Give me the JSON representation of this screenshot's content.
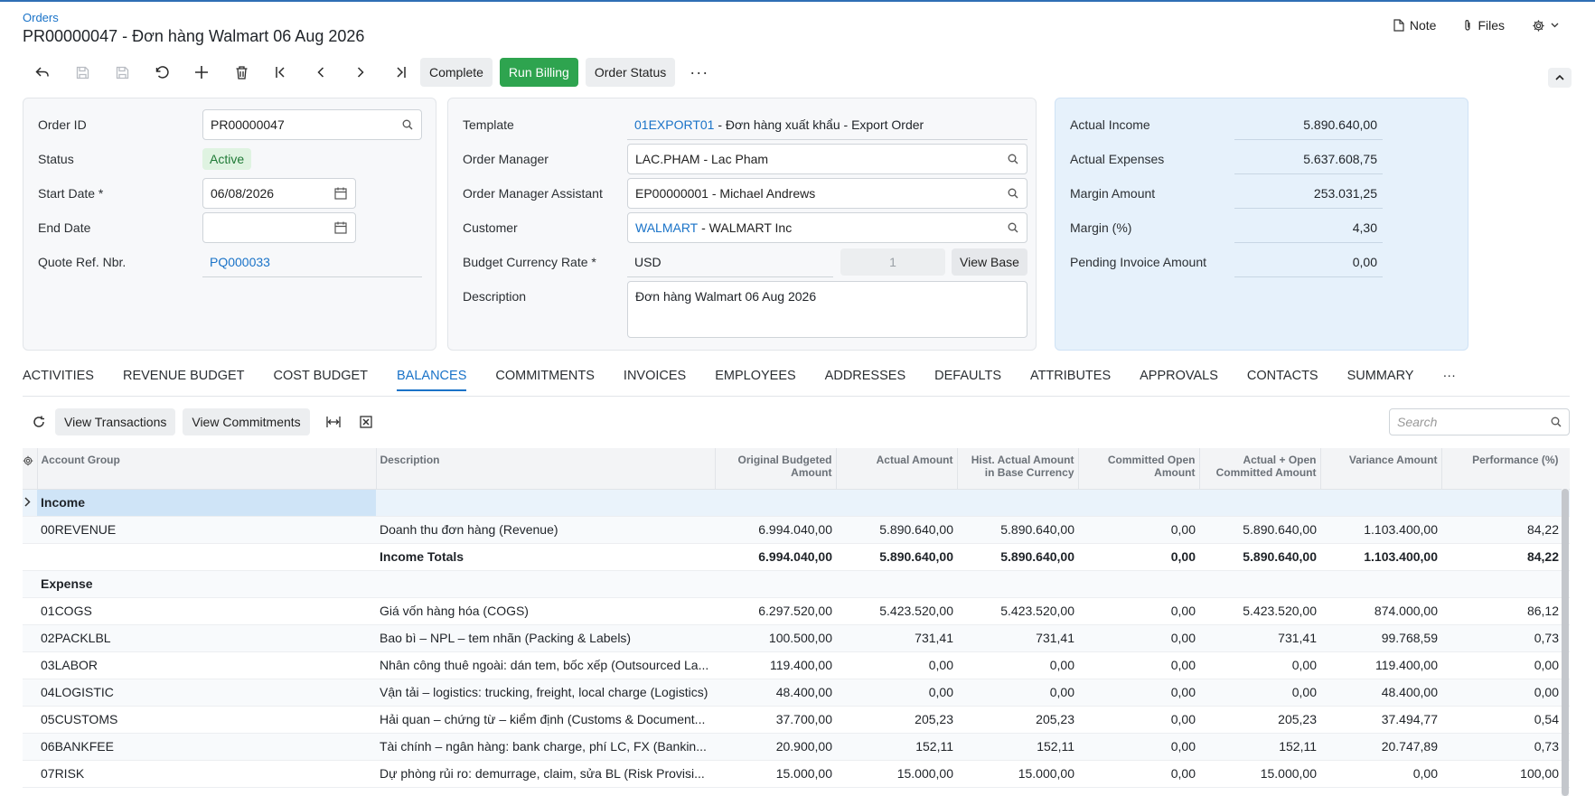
{
  "header": {
    "breadcrumb": "Orders",
    "title": "PR00000047 - Đơn hàng Walmart 06 Aug 2026",
    "note_label": "Note",
    "files_label": "Files"
  },
  "toolbar": {
    "complete_label": "Complete",
    "run_billing_label": "Run Billing",
    "order_status_label": "Order Status",
    "more_label": "···"
  },
  "summary": {
    "order_id_label": "Order ID",
    "order_id": "PR00000047",
    "status_label": "Status",
    "status": "Active",
    "start_date_label": "Start Date *",
    "start_date": "06/08/2026",
    "end_date_label": "End Date",
    "end_date": "",
    "quote_ref_label": "Quote Ref. Nbr.",
    "quote_ref": "PQ000033",
    "template_label": "Template",
    "template_code": "01EXPORT01",
    "template_desc": " - Đơn hàng xuất khẩu - Export Order",
    "order_manager_label": "Order Manager",
    "order_manager": "LAC.PHAM - Lac Pham",
    "order_manager_assistant_label": "Order Manager Assistant",
    "order_manager_assistant": "EP00000001 - Michael Andrews",
    "customer_label": "Customer",
    "customer_code": "WALMART",
    "customer_desc": " - WALMART Inc",
    "budget_currency_label": "Budget Currency Rate *",
    "budget_currency": "USD",
    "currency_rate": "1",
    "view_base_label": "View Base",
    "description_label": "Description",
    "description": "Đơn hàng Walmart 06 Aug 2026"
  },
  "totals": {
    "actual_income_label": "Actual Income",
    "actual_income": "5.890.640,00",
    "actual_expenses_label": "Actual Expenses",
    "actual_expenses": "5.637.608,75",
    "margin_amount_label": "Margin Amount",
    "margin_amount": "253.031,25",
    "margin_pct_label": "Margin (%)",
    "margin_pct": "4,30",
    "pending_invoice_label": "Pending Invoice Amount",
    "pending_invoice": "0,00"
  },
  "tabs": [
    "ACTIVITIES",
    "REVENUE BUDGET",
    "COST BUDGET",
    "BALANCES",
    "COMMITMENTS",
    "INVOICES",
    "EMPLOYEES",
    "ADDRESSES",
    "DEFAULTS",
    "ATTRIBUTES",
    "APPROVALS",
    "CONTACTS",
    "SUMMARY"
  ],
  "active_tab": "BALANCES",
  "grid_toolbar": {
    "view_transactions_label": "View Transactions",
    "view_commitments_label": "View Commitments",
    "search_placeholder": "Search"
  },
  "table": {
    "columns": {
      "account_group": "Account Group",
      "description": "Description",
      "original_budgeted_l1": "Original Budgeted",
      "original_budgeted_l2": "Amount",
      "actual_amount": "Actual Amount",
      "hist_actual_l1": "Hist. Actual Amount",
      "hist_actual_l2": "in Base Currency",
      "committed_open_l1": "Committed Open",
      "committed_open_l2": "Amount",
      "actual_open_l1": "Actual + Open",
      "actual_open_l2": "Committed Amount",
      "variance": "Variance Amount",
      "performance": "Performance (%)"
    },
    "income_group": "Income",
    "expense_group": "Expense",
    "income_row": {
      "group": "00REVENUE",
      "desc": "Doanh thu đơn hàng (Revenue)",
      "budget": "6.994.040,00",
      "actual": "5.890.640,00",
      "hist": "5.890.640,00",
      "committed": "0,00",
      "actual_open": "5.890.640,00",
      "variance": "1.103.400,00",
      "perf": "84,22"
    },
    "income_totals": {
      "desc": "Income Totals",
      "budget": "6.994.040,00",
      "actual": "5.890.640,00",
      "hist": "5.890.640,00",
      "committed": "0,00",
      "actual_open": "5.890.640,00",
      "variance": "1.103.400,00",
      "perf": "84,22"
    },
    "expense_rows": [
      {
        "group": "01COGS",
        "desc": "Giá vốn hàng hóa (COGS)",
        "budget": "6.297.520,00",
        "actual": "5.423.520,00",
        "hist": "5.423.520,00",
        "committed": "0,00",
        "actual_open": "5.423.520,00",
        "variance": "874.000,00",
        "perf": "86,12"
      },
      {
        "group": "02PACKLBL",
        "desc": "Bao bì – NPL – tem nhãn (Packing & Labels)",
        "budget": "100.500,00",
        "actual": "731,41",
        "hist": "731,41",
        "committed": "0,00",
        "actual_open": "731,41",
        "variance": "99.768,59",
        "perf": "0,73"
      },
      {
        "group": "03LABOR",
        "desc": "Nhân công thuê ngoài: dán tem, bốc xếp (Outsourced La...",
        "budget": "119.400,00",
        "actual": "0,00",
        "hist": "0,00",
        "committed": "0,00",
        "actual_open": "0,00",
        "variance": "119.400,00",
        "perf": "0,00"
      },
      {
        "group": "04LOGISTIC",
        "desc": "Vận tải – logistics: trucking, freight, local charge (Logistics)",
        "budget": "48.400,00",
        "actual": "0,00",
        "hist": "0,00",
        "committed": "0,00",
        "actual_open": "0,00",
        "variance": "48.400,00",
        "perf": "0,00"
      },
      {
        "group": "05CUSTOMS",
        "desc": "Hải quan – chứng từ – kiểm định (Customs & Document...",
        "budget": "37.700,00",
        "actual": "205,23",
        "hist": "205,23",
        "committed": "0,00",
        "actual_open": "205,23",
        "variance": "37.494,77",
        "perf": "0,54"
      },
      {
        "group": "06BANKFEE",
        "desc": "Tài chính – ngân hàng: bank charge, phí LC, FX (Bankin...",
        "budget": "20.900,00",
        "actual": "152,11",
        "hist": "152,11",
        "committed": "0,00",
        "actual_open": "152,11",
        "variance": "20.747,89",
        "perf": "0,73"
      },
      {
        "group": "07RISK",
        "desc": "Dự phòng rủi ro: demurrage, claim, sửa BL (Risk Provisi...",
        "budget": "15.000,00",
        "actual": "15.000,00",
        "hist": "15.000,00",
        "committed": "0,00",
        "actual_open": "15.000,00",
        "variance": "0,00",
        "perf": "100,00"
      }
    ]
  }
}
